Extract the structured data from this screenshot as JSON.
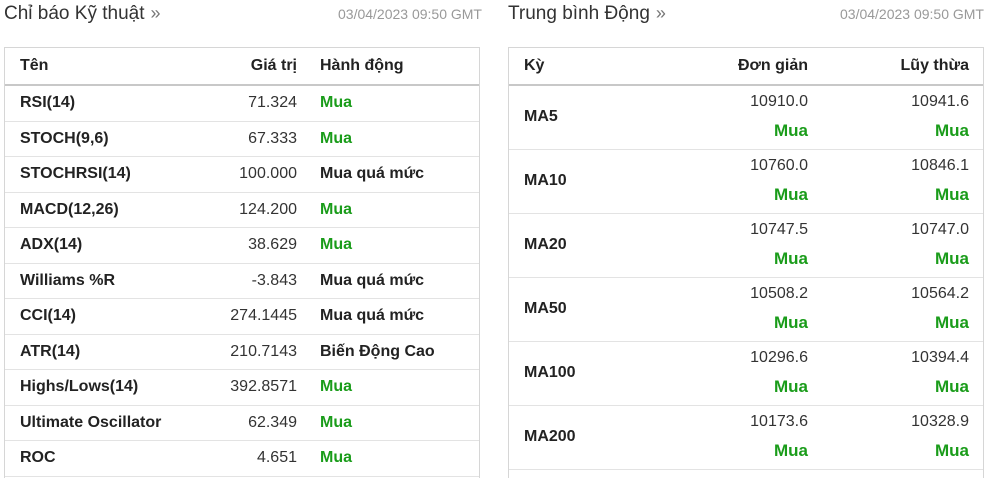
{
  "indicators": {
    "title": "Chỉ báo Kỹ thuật",
    "raquo": "»",
    "timestamp": "03/04/2023 09:50 GMT",
    "headers": {
      "name": "Tên",
      "value": "Giá trị",
      "action": "Hành động"
    },
    "rows": [
      {
        "name": "RSI(14)",
        "value": "71.324",
        "action": "Mua"
      },
      {
        "name": "STOCH(9,6)",
        "value": "67.333",
        "action": "Mua"
      },
      {
        "name": "STOCHRSI(14)",
        "value": "100.000",
        "action": "Mua quá mức"
      },
      {
        "name": "MACD(12,26)",
        "value": "124.200",
        "action": "Mua"
      },
      {
        "name": "ADX(14)",
        "value": "38.629",
        "action": "Mua"
      },
      {
        "name": "Williams %R",
        "value": "-3.843",
        "action": "Mua quá mức"
      },
      {
        "name": "CCI(14)",
        "value": "274.1445",
        "action": "Mua quá mức"
      },
      {
        "name": "ATR(14)",
        "value": "210.7143",
        "action": "Biến Động Cao"
      },
      {
        "name": "Highs/Lows(14)",
        "value": "392.8571",
        "action": "Mua"
      },
      {
        "name": "Ultimate Oscillator",
        "value": "62.349",
        "action": "Mua"
      },
      {
        "name": "ROC",
        "value": "4.651",
        "action": "Mua"
      }
    ]
  },
  "moving_averages": {
    "title": "Trung bình Động",
    "raquo": "»",
    "timestamp": "03/04/2023 09:50 GMT",
    "headers": {
      "period": "Kỳ",
      "simple": "Đơn giản",
      "exponential": "Lũy thừa"
    },
    "rows": [
      {
        "name": "MA5",
        "simple": "10910.0",
        "simple_signal": "Mua",
        "exp": "10941.6",
        "exp_signal": "Mua"
      },
      {
        "name": "MA10",
        "simple": "10760.0",
        "simple_signal": "Mua",
        "exp": "10846.1",
        "exp_signal": "Mua"
      },
      {
        "name": "MA20",
        "simple": "10747.5",
        "simple_signal": "Mua",
        "exp": "10747.0",
        "exp_signal": "Mua"
      },
      {
        "name": "MA50",
        "simple": "10508.2",
        "simple_signal": "Mua",
        "exp": "10564.2",
        "exp_signal": "Mua"
      },
      {
        "name": "MA100",
        "simple": "10296.6",
        "simple_signal": "Mua",
        "exp": "10394.4",
        "exp_signal": "Mua"
      },
      {
        "name": "MA200",
        "simple": "10173.6",
        "simple_signal": "Mua",
        "exp": "10328.9",
        "exp_signal": "Mua"
      }
    ]
  },
  "colors": {
    "buy": "#1a9c1a",
    "neutral": "#222222"
  }
}
